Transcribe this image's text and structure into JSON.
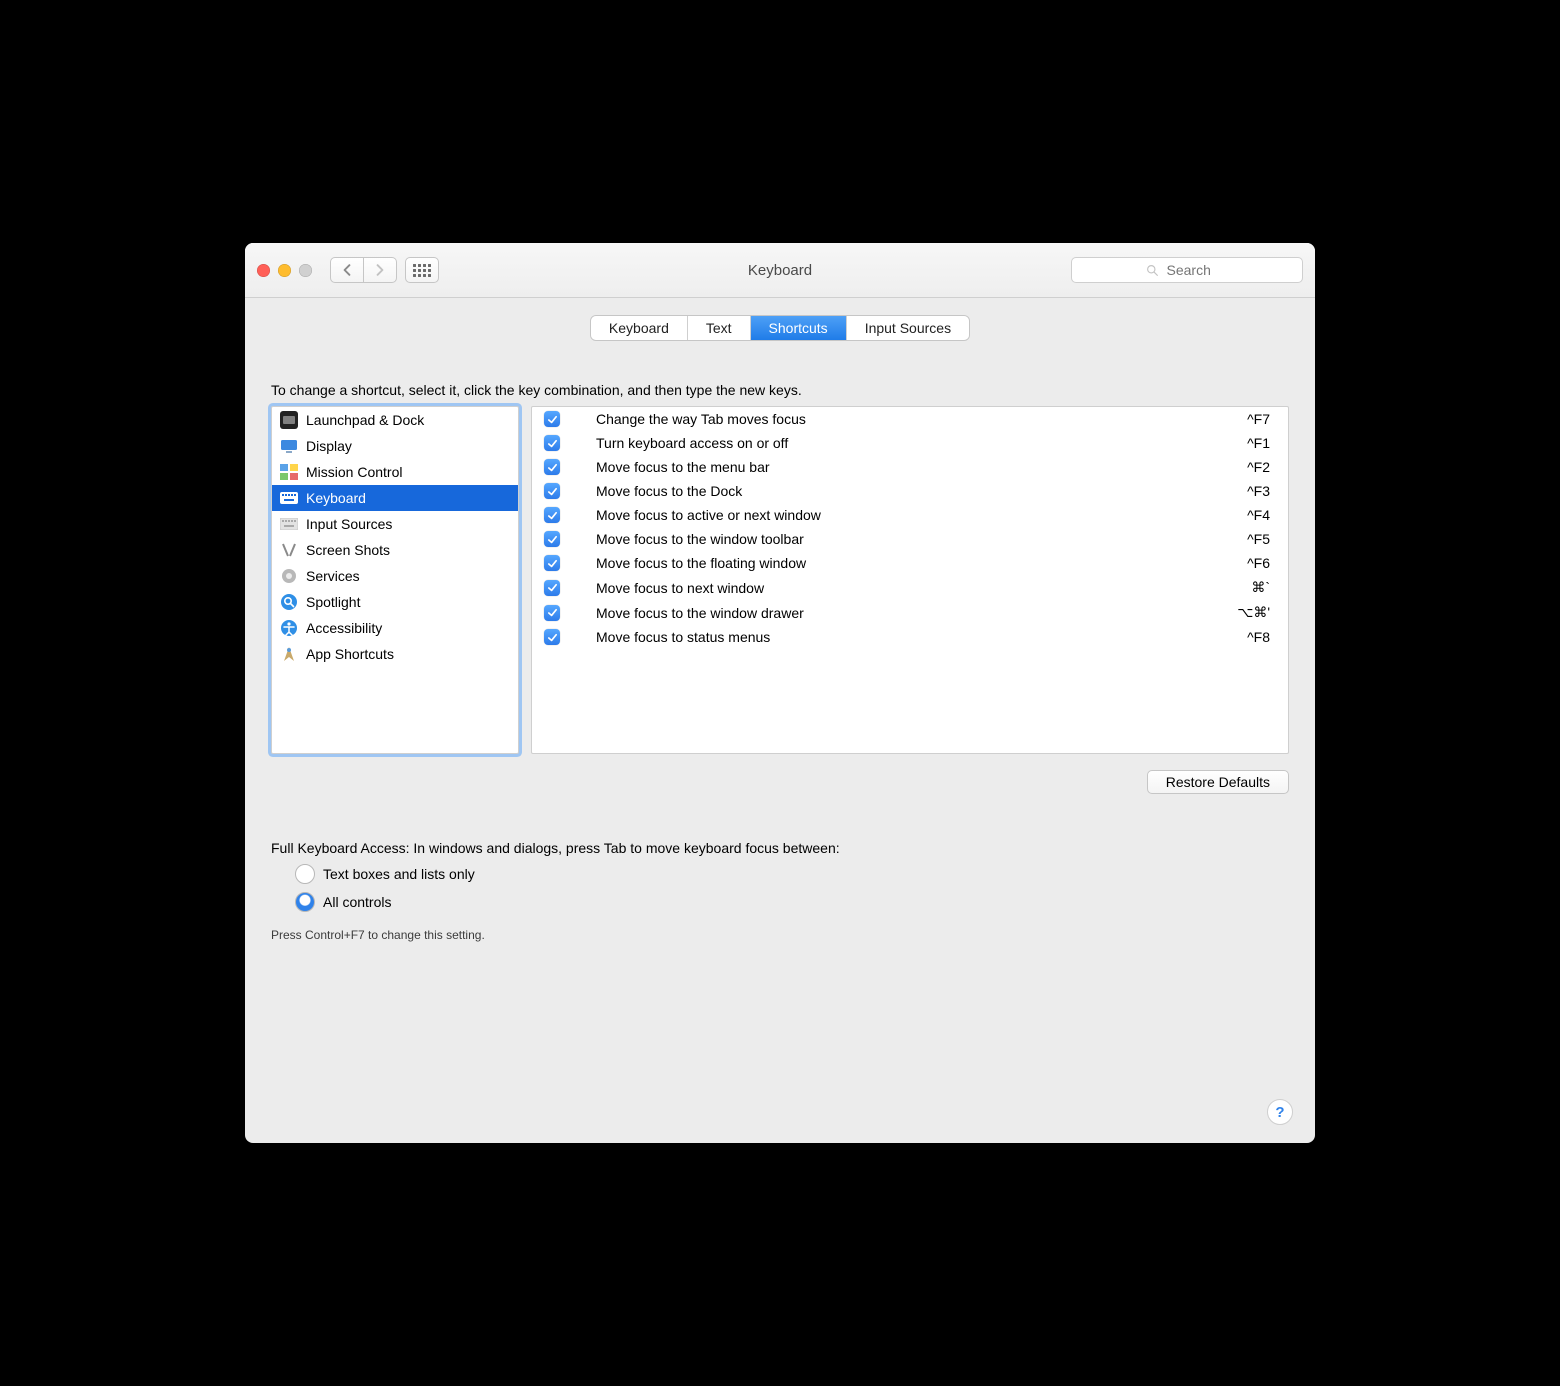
{
  "window": {
    "title": "Keyboard"
  },
  "toolbar": {
    "search_placeholder": "Search"
  },
  "tabs": [
    {
      "label": "Keyboard",
      "active": false
    },
    {
      "label": "Text",
      "active": false
    },
    {
      "label": "Shortcuts",
      "active": true
    },
    {
      "label": "Input Sources",
      "active": false
    }
  ],
  "instruction": "To change a shortcut, select it, click the key combination, and then type the new keys.",
  "categories": [
    {
      "label": "Launchpad & Dock",
      "icon": "launchpad",
      "selected": false
    },
    {
      "label": "Display",
      "icon": "display",
      "selected": false
    },
    {
      "label": "Mission Control",
      "icon": "mission",
      "selected": false
    },
    {
      "label": "Keyboard",
      "icon": "keyboard",
      "selected": true
    },
    {
      "label": "Input Sources",
      "icon": "keyboard2",
      "selected": false
    },
    {
      "label": "Screen Shots",
      "icon": "screenshots",
      "selected": false
    },
    {
      "label": "Services",
      "icon": "services",
      "selected": false
    },
    {
      "label": "Spotlight",
      "icon": "spotlight",
      "selected": false
    },
    {
      "label": "Accessibility",
      "icon": "accessibility",
      "selected": false
    },
    {
      "label": "App Shortcuts",
      "icon": "appshortcuts",
      "selected": false
    }
  ],
  "shortcuts": [
    {
      "checked": true,
      "label": "Change the way Tab moves focus",
      "keys": "^F7"
    },
    {
      "checked": true,
      "label": "Turn keyboard access on or off",
      "keys": "^F1"
    },
    {
      "checked": true,
      "label": "Move focus to the menu bar",
      "keys": "^F2"
    },
    {
      "checked": true,
      "label": "Move focus to the Dock",
      "keys": "^F3"
    },
    {
      "checked": true,
      "label": "Move focus to active or next window",
      "keys": "^F4"
    },
    {
      "checked": true,
      "label": "Move focus to the window toolbar",
      "keys": "^F5"
    },
    {
      "checked": true,
      "label": "Move focus to the floating window",
      "keys": "^F6"
    },
    {
      "checked": true,
      "label": "Move focus to next window",
      "keys": "⌘`"
    },
    {
      "checked": true,
      "label": "Move focus to the window drawer",
      "keys": "⌥⌘'"
    },
    {
      "checked": true,
      "label": "Move focus to status menus",
      "keys": "^F8"
    }
  ],
  "restore_label": "Restore Defaults",
  "fka": {
    "title": "Full Keyboard Access: In windows and dialogs, press Tab to move keyboard focus between:",
    "options": [
      {
        "label": "Text boxes and lists only",
        "selected": false
      },
      {
        "label": "All controls",
        "selected": true
      }
    ],
    "hint": "Press Control+F7 to change this setting."
  },
  "help_label": "?"
}
